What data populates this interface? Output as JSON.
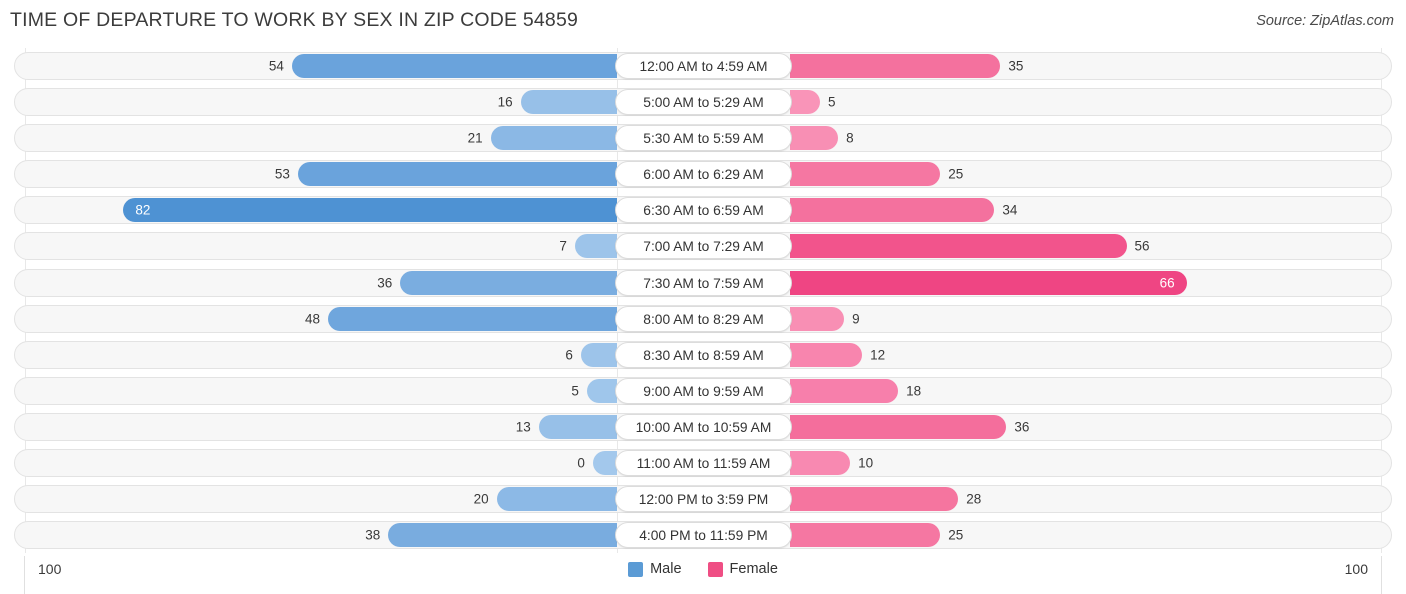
{
  "header": {
    "title": "TIME OF DEPARTURE TO WORK BY SEX IN ZIP CODE 54859",
    "source": "Source: ZipAtlas.com"
  },
  "legend": {
    "male_label": "Male",
    "female_label": "Female",
    "male_color": "#5b9bd5",
    "female_color": "#ef4e84"
  },
  "axis": {
    "left_max": "100",
    "right_max": "100",
    "scale_max": 100
  },
  "chart_data": {
    "type": "bar",
    "subtype": "diverging-bar",
    "title": "TIME OF DEPARTURE TO WORK BY SEX IN ZIP CODE 54859",
    "xlabel": "",
    "ylabel": "",
    "xlim": [
      100,
      100
    ],
    "grid": false,
    "legend_position": "bottom-center",
    "categories": [
      "12:00 AM to 4:59 AM",
      "5:00 AM to 5:29 AM",
      "5:30 AM to 5:59 AM",
      "6:00 AM to 6:29 AM",
      "6:30 AM to 6:59 AM",
      "7:00 AM to 7:29 AM",
      "7:30 AM to 7:59 AM",
      "8:00 AM to 8:29 AM",
      "8:30 AM to 8:59 AM",
      "9:00 AM to 9:59 AM",
      "10:00 AM to 10:59 AM",
      "11:00 AM to 11:59 AM",
      "12:00 PM to 3:59 PM",
      "4:00 PM to 11:59 PM"
    ],
    "series": [
      {
        "name": "Male",
        "values": [
          54,
          16,
          21,
          53,
          82,
          7,
          36,
          48,
          6,
          5,
          13,
          0,
          20,
          38
        ]
      },
      {
        "name": "Female",
        "values": [
          35,
          5,
          8,
          25,
          34,
          56,
          66,
          9,
          12,
          18,
          36,
          10,
          28,
          25
        ]
      }
    ]
  },
  "rows": [
    {
      "category": "12:00 AM to 4:59 AM",
      "male": "54",
      "female": "35",
      "male_val": 54,
      "female_val": 35,
      "male_color": "#6aa3dc",
      "female_color": "#f4719e",
      "male_inside": false,
      "female_inside": false
    },
    {
      "category": "5:00 AM to 5:29 AM",
      "male": "16",
      "female": "5",
      "male_val": 16,
      "female_val": 5,
      "male_color": "#97c0e8",
      "female_color": "#f994b8",
      "male_inside": false,
      "female_inside": false
    },
    {
      "category": "5:30 AM to 5:59 AM",
      "male": "21",
      "female": "8",
      "male_val": 21,
      "female_val": 8,
      "male_color": "#8bb8e5",
      "female_color": "#f88fb4",
      "male_inside": false,
      "female_inside": false
    },
    {
      "category": "6:00 AM to 6:29 AM",
      "male": "53",
      "female": "25",
      "male_val": 53,
      "female_val": 25,
      "male_color": "#6aa3dc",
      "female_color": "#f577a2",
      "male_inside": false,
      "female_inside": false
    },
    {
      "category": "6:30 AM to 6:59 AM",
      "male": "82",
      "female": "34",
      "male_val": 82,
      "female_val": 34,
      "male_color": "#4e92d3",
      "female_color": "#f4719e",
      "male_inside": true,
      "female_inside": false
    },
    {
      "category": "7:00 AM to 7:29 AM",
      "male": "7",
      "female": "56",
      "male_val": 7,
      "female_val": 56,
      "male_color": "#9dc4ea",
      "female_color": "#f2548c",
      "male_inside": false,
      "female_inside": false
    },
    {
      "category": "7:30 AM to 7:59 AM",
      "male": "36",
      "female": "66",
      "male_val": 36,
      "female_val": 66,
      "male_color": "#7aadE0",
      "female_color": "#ef4583",
      "male_inside": false,
      "female_inside": true
    },
    {
      "category": "8:00 AM to 8:29 AM",
      "male": "48",
      "female": "9",
      "male_val": 48,
      "female_val": 9,
      "male_color": "#6fa6dd",
      "female_color": "#f88fb4",
      "male_inside": false,
      "female_inside": false
    },
    {
      "category": "8:30 AM to 8:59 AM",
      "male": "6",
      "female": "12",
      "male_val": 6,
      "female_val": 12,
      "male_color": "#9dc4ea",
      "female_color": "#f885ae",
      "male_inside": false,
      "female_inside": false
    },
    {
      "category": "9:00 AM to 9:59 AM",
      "male": "5",
      "female": "18",
      "male_val": 5,
      "female_val": 18,
      "male_color": "#9fc6eb",
      "female_color": "#f77fab",
      "male_inside": false,
      "female_inside": false
    },
    {
      "category": "10:00 AM to 10:59 AM",
      "male": "13",
      "female": "36",
      "male_val": 13,
      "female_val": 36,
      "male_color": "#97c0e8",
      "female_color": "#f46e9c",
      "male_inside": false,
      "female_inside": false
    },
    {
      "category": "11:00 AM to 11:59 AM",
      "male": "0",
      "female": "10",
      "male_val": 4,
      "female_val": 10,
      "male_color": "#a3c8ec",
      "female_color": "#f889b1",
      "male_inside": false,
      "female_inside": false
    },
    {
      "category": "12:00 PM to 3:59 PM",
      "male": "20",
      "female": "28",
      "male_val": 20,
      "female_val": 28,
      "male_color": "#8cb9e6",
      "female_color": "#f5759f",
      "male_inside": false,
      "female_inside": false
    },
    {
      "category": "4:00 PM to 11:59 PM",
      "male": "38",
      "female": "25",
      "male_val": 38,
      "female_val": 25,
      "male_color": "#79acdf",
      "female_color": "#f577a2",
      "male_inside": false,
      "female_inside": false
    }
  ]
}
